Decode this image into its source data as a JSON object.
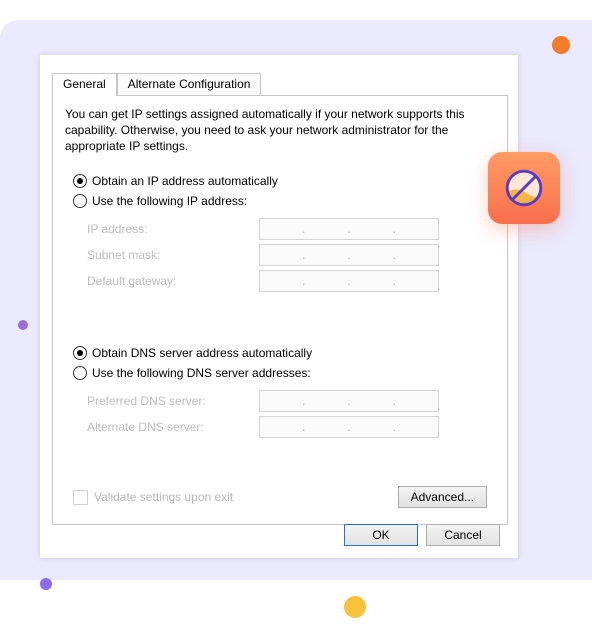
{
  "tabs": {
    "general": "General",
    "alt": "Alternate Configuration"
  },
  "intro": "You can get IP settings assigned automatically if your network supports this capability. Otherwise, you need to ask your network administrator for the appropriate IP settings.",
  "ip": {
    "auto": "Obtain an IP address automatically",
    "manual": "Use the following IP address:",
    "labels": {
      "ip": "IP address:",
      "mask": "Subnet mask:",
      "gateway": "Default gateway:"
    }
  },
  "dns": {
    "auto": "Obtain DNS server address automatically",
    "manual": "Use the following DNS server addresses:",
    "labels": {
      "pref": "Preferred DNS server:",
      "alt": "Alternate DNS server:"
    }
  },
  "validate": "Validate settings upon exit",
  "buttons": {
    "advanced": "Advanced...",
    "ok": "OK",
    "cancel": "Cancel"
  },
  "badge_icon": "prohibit-icon",
  "colors": {
    "accent_border": "#2d6fc7",
    "badge_gradient_top": "#ff9c64",
    "badge_gradient_bottom": "#f86f4c"
  }
}
